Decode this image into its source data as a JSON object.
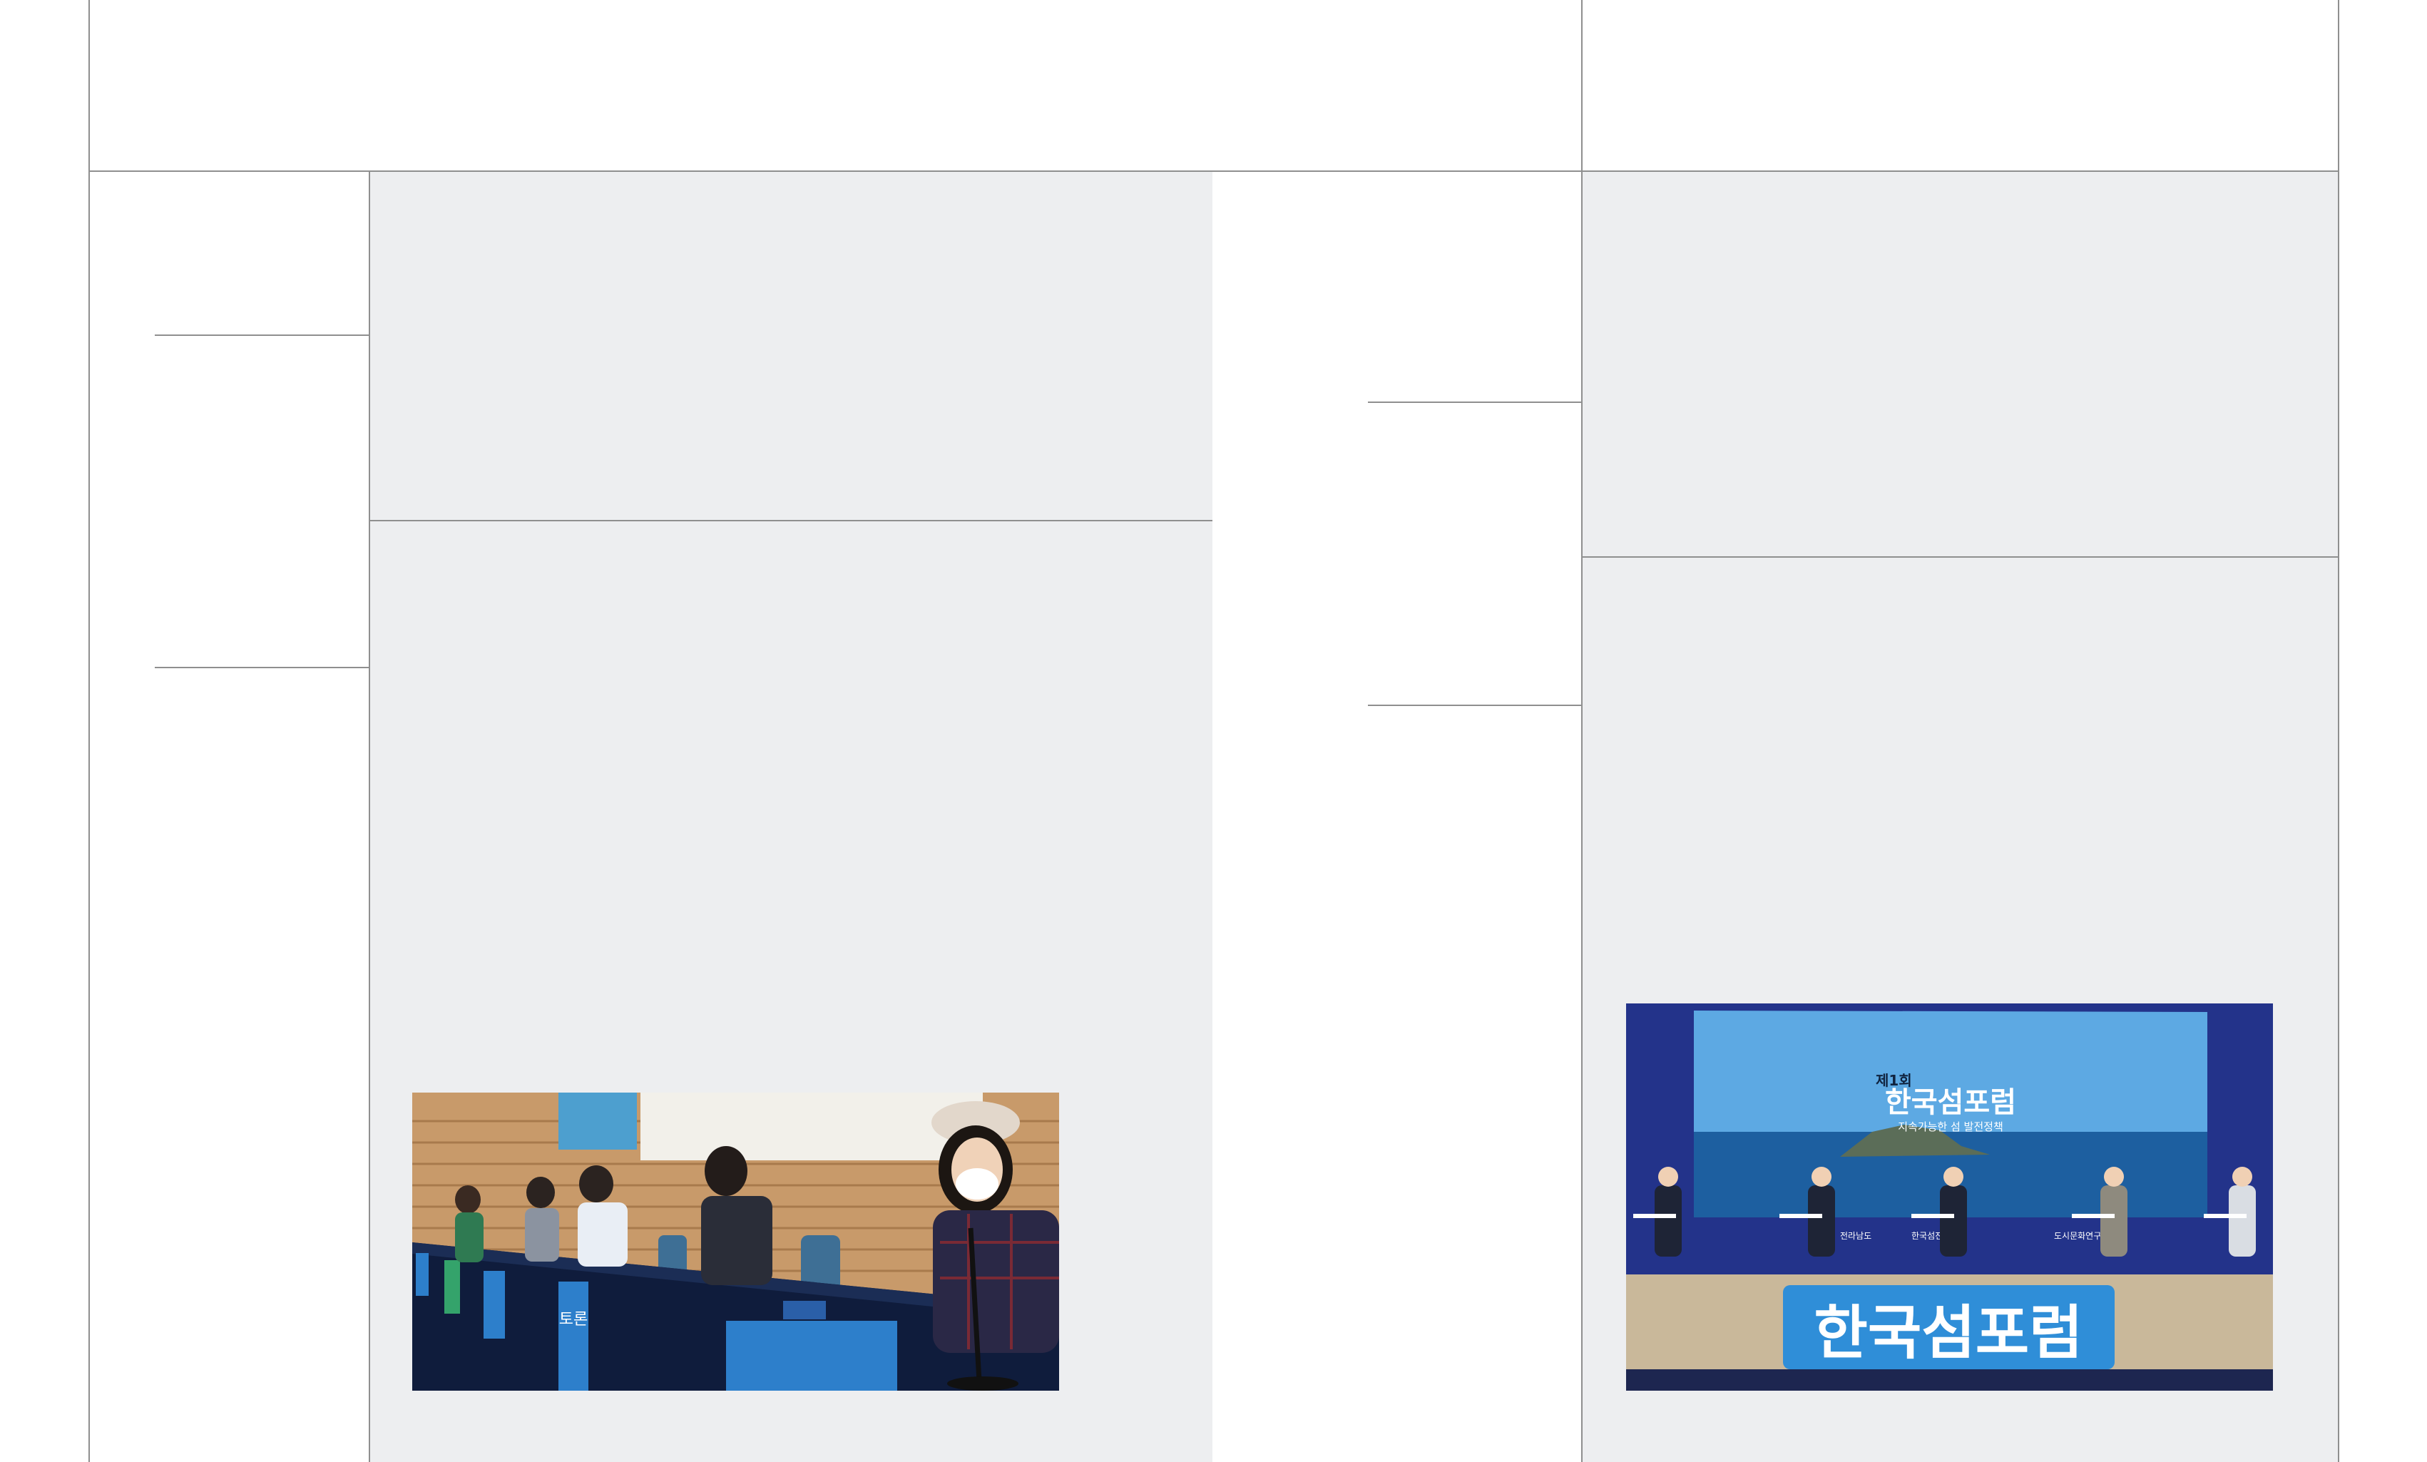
{
  "photos": {
    "panel_discussion": {
      "sign_text": "토론"
    },
    "forum_stage": {
      "screen_edition": "제1회",
      "screen_title": "한국섬포럼",
      "screen_subtitle": "지속가능한 섬 발전정책",
      "stage_sign": "한국섬포럼",
      "sponsor_1": "전라남도",
      "sponsor_2": "한국섬진흥원",
      "sponsor_3": "도시문화연구원"
    }
  }
}
